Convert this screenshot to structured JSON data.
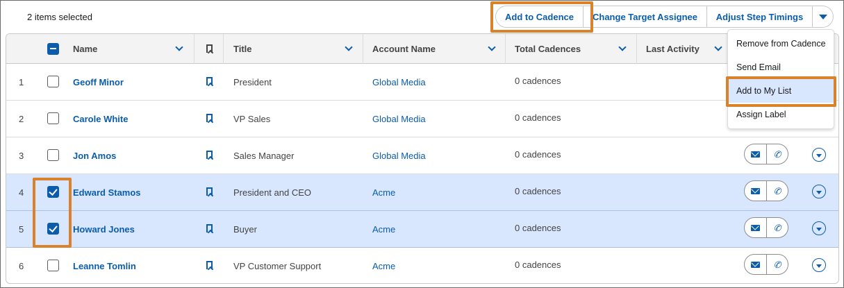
{
  "toolbar": {
    "selected_count": "2 items selected",
    "add_to_cadence": "Add to Cadence",
    "change_target_assignee": "Change Target Assignee",
    "adjust_step_timings": "Adjust Step Timings"
  },
  "table": {
    "columns": {
      "name": "Name",
      "title": "Title",
      "account": "Account Name",
      "cadences": "Total Cadences",
      "activity": "Last Activity"
    },
    "rows": [
      {
        "num": "1",
        "name": "Geoff Minor",
        "title": "President",
        "account": "Global Media",
        "cadences": "0 cadences",
        "checked": false
      },
      {
        "num": "2",
        "name": "Carole White",
        "title": "VP Sales",
        "account": "Global Media",
        "cadences": "0 cadences",
        "checked": false
      },
      {
        "num": "3",
        "name": "Jon Amos",
        "title": "Sales Manager",
        "account": "Global Media",
        "cadences": "0 cadences",
        "checked": false
      },
      {
        "num": "4",
        "name": "Edward Stamos",
        "title": "President and CEO",
        "account": "Acme",
        "cadences": "0 cadences",
        "checked": true
      },
      {
        "num": "5",
        "name": "Howard Jones",
        "title": "Buyer",
        "account": "Acme",
        "cadences": "0 cadences",
        "checked": true
      },
      {
        "num": "6",
        "name": "Leanne Tomlin",
        "title": "VP Customer Support",
        "account": "Acme",
        "cadences": "0 cadences",
        "checked": false
      }
    ]
  },
  "menu": {
    "items": [
      "Remove from Cadence",
      "Send Email",
      "Add to My List",
      "Assign Label"
    ],
    "highlighted": "Add to My List"
  },
  "icons": {
    "email": "envelope-icon",
    "call": "phone-icon",
    "bookmark": "bookmark-icon",
    "row_menu": "chevron-down-circle-icon"
  },
  "colors": {
    "brand": "#0b5cab",
    "selected_row": "#d8e6fe",
    "callout": "#d9822b"
  }
}
